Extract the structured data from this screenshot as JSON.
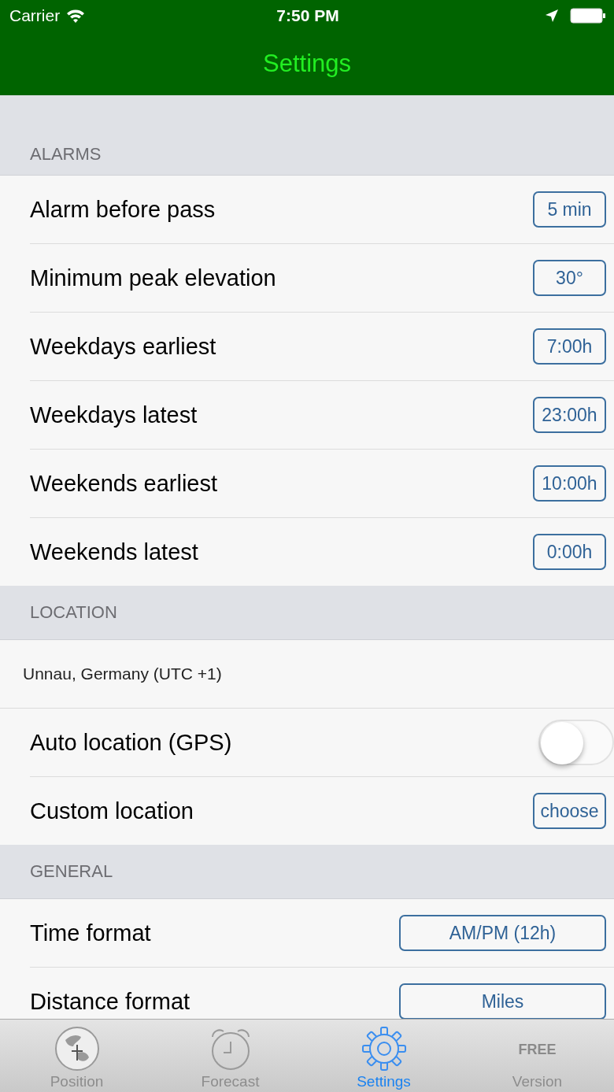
{
  "status_bar": {
    "carrier": "Carrier",
    "time": "7:50 PM"
  },
  "nav": {
    "title": "Settings"
  },
  "sections": [
    {
      "header": "ALARMS",
      "rows": [
        {
          "kind": "picker",
          "label": "Alarm before pass",
          "value": "5 min"
        },
        {
          "kind": "picker",
          "label": "Minimum peak elevation",
          "value": "30°"
        },
        {
          "kind": "picker",
          "label": "Weekdays earliest",
          "value": "7:00h"
        },
        {
          "kind": "picker",
          "label": "Weekdays latest",
          "value": "23:00h"
        },
        {
          "kind": "picker",
          "label": "Weekends earliest",
          "value": "10:00h"
        },
        {
          "kind": "picker",
          "label": "Weekends latest",
          "value": "0:00h"
        }
      ]
    },
    {
      "header": "LOCATION",
      "rows": [
        {
          "kind": "info",
          "label": "Unnau, Germany (UTC +1)"
        },
        {
          "kind": "toggle",
          "label": "Auto location (GPS)",
          "on": false
        },
        {
          "kind": "picker",
          "label": "Custom location",
          "value": "choose"
        }
      ]
    },
    {
      "header": "GENERAL",
      "rows": [
        {
          "kind": "wide",
          "label": "Time format",
          "value": "AM/PM (12h)"
        },
        {
          "kind": "wide",
          "label": "Distance format",
          "value": "Miles"
        }
      ]
    }
  ],
  "tab_bar": [
    {
      "kind": "globe",
      "label": "Position",
      "selected": false
    },
    {
      "kind": "alarm",
      "label": "Forecast",
      "selected": false
    },
    {
      "kind": "gear",
      "label": "Settings",
      "selected": true
    },
    {
      "kind": "free",
      "label": "Version",
      "selected": false,
      "badge": "FREE"
    }
  ]
}
